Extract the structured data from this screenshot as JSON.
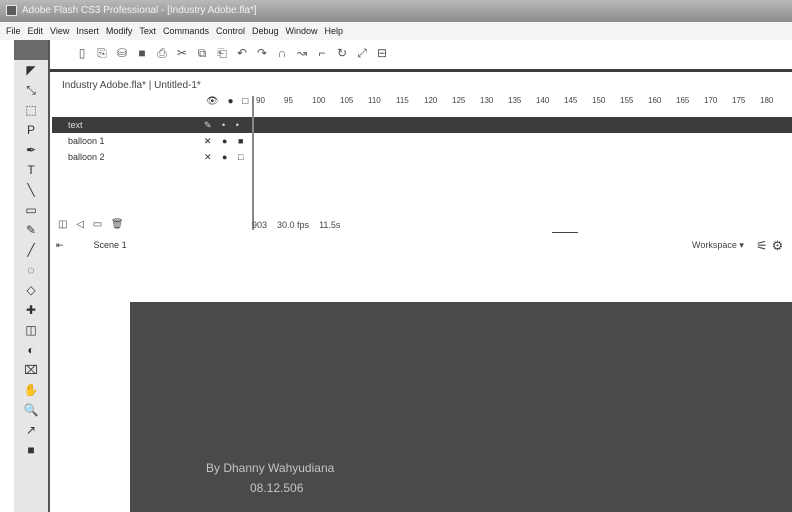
{
  "window": {
    "title": "Adobe Flash CS3 Professional - [Industry Adobe.fla*]"
  },
  "menu": [
    "File",
    "Edit",
    "View",
    "Insert",
    "Modify",
    "Text",
    "Commands",
    "Control",
    "Debug",
    "Window",
    "Help"
  ],
  "toolbar": {
    "icons": [
      "new",
      "open",
      "save-all",
      "save",
      "print",
      "cut",
      "copy",
      "paste",
      "undo",
      "redo",
      "snap",
      "smooth",
      "straighten",
      "rotate",
      "scale",
      "align"
    ]
  },
  "tools": [
    "◤",
    "⤡",
    "⬚",
    "P",
    "✒",
    "T",
    "╲",
    "▭",
    "✎",
    "╱",
    "◌",
    "◇",
    "✚",
    "◫",
    "◐",
    "⌧",
    "✋",
    "🔍",
    "↗",
    "■"
  ],
  "document": {
    "tabs": "Industry Adobe.fla* | Untitled-1*"
  },
  "timeline": {
    "header_icons": "👁 ● □",
    "ruler": [
      "90",
      "95",
      "100",
      "105",
      "110",
      "115",
      "120",
      "125",
      "130",
      "135",
      "140",
      "145",
      "150",
      "155",
      "160",
      "165",
      "170",
      "175",
      "180"
    ],
    "layers": [
      {
        "name": "text",
        "ctrls": "✎ • • ■"
      },
      {
        "name": "balloon 1",
        "ctrls": "✕ ● ■"
      },
      {
        "name": "balloon 2",
        "ctrls": "✕ ● □"
      }
    ],
    "left_icons": "◫ ◁ ▭ 🗑",
    "footer": {
      "frame": "903",
      "fps": "30.0 fps",
      "time": "11.5s"
    }
  },
  "editbar": {
    "scene": "Scene 1"
  },
  "workspace": {
    "label": "Workspace ▾"
  },
  "stage": {
    "credit": "By Dhanny Wahyudiana",
    "date": "08.12.506"
  },
  "colors": {
    "stage": "#4a4a4a",
    "selected_layer": "#3c3c3c"
  }
}
